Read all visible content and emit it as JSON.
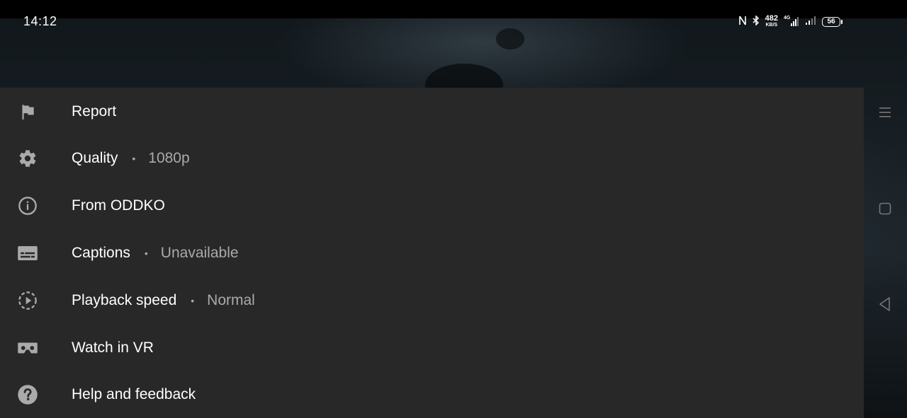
{
  "status_bar": {
    "time": "14:12",
    "network_speed": "482",
    "network_speed_unit": "KB/S",
    "network_type": "4G",
    "battery": "56",
    "icons": [
      "nfc-icon",
      "bluetooth-icon",
      "mobile-signal-icon",
      "wifi-signal-icon",
      "battery-icon"
    ]
  },
  "menu": {
    "items": [
      {
        "icon": "flag-icon",
        "label": "Report",
        "value": ""
      },
      {
        "icon": "gear-icon",
        "label": "Quality",
        "value": "1080p"
      },
      {
        "icon": "info-icon",
        "label": "From ODDKO",
        "value": ""
      },
      {
        "icon": "captions-icon",
        "label": "Captions",
        "value": "Unavailable"
      },
      {
        "icon": "playback-speed-icon",
        "label": "Playback speed",
        "value": "Normal"
      },
      {
        "icon": "vr-headset-icon",
        "label": "Watch in VR",
        "value": ""
      },
      {
        "icon": "help-icon",
        "label": "Help and feedback",
        "value": ""
      }
    ],
    "separator": "•"
  },
  "nav_bar": {
    "icons": [
      "menu-icon",
      "home-icon",
      "back-icon"
    ]
  },
  "colors": {
    "sheet_background": "#282828",
    "primary_text": "#ffffff",
    "secondary_text": "#aaaaaa",
    "icon": "#aaaaaa"
  }
}
